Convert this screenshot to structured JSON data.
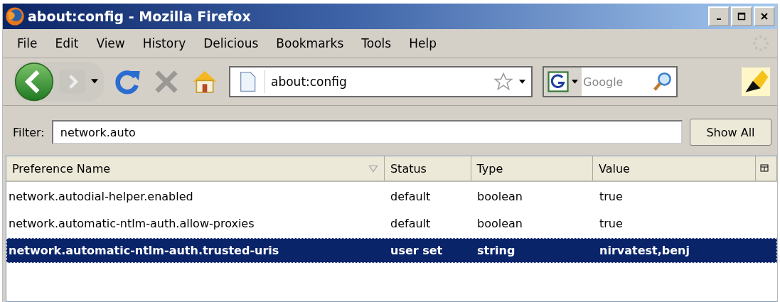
{
  "window": {
    "title": "about:config - Mozilla Firefox"
  },
  "menu": [
    "File",
    "Edit",
    "View",
    "History",
    "Delicious",
    "Bookmarks",
    "Tools",
    "Help"
  ],
  "toolbar": {
    "address": "about:config",
    "search_placeholder": "Google"
  },
  "filter": {
    "label": "Filter:",
    "value": "network.auto",
    "button": "Show All"
  },
  "table": {
    "columns": [
      {
        "label": "Preference Name",
        "sorted": true
      },
      {
        "label": "Status",
        "sorted": false
      },
      {
        "label": "Type",
        "sorted": false
      },
      {
        "label": "Value",
        "sorted": false
      }
    ],
    "rows": [
      {
        "cells": [
          "network.autodial-helper.enabled",
          "default",
          "boolean",
          "true"
        ],
        "modified": false,
        "selected": false
      },
      {
        "cells": [
          "network.automatic-ntlm-auth.allow-proxies",
          "default",
          "boolean",
          "true"
        ],
        "modified": false,
        "selected": false
      },
      {
        "cells": [
          "network.automatic-ntlm-auth.trusted-uris",
          "user set",
          "string",
          "nirvatest,benj"
        ],
        "modified": true,
        "selected": true
      }
    ]
  }
}
